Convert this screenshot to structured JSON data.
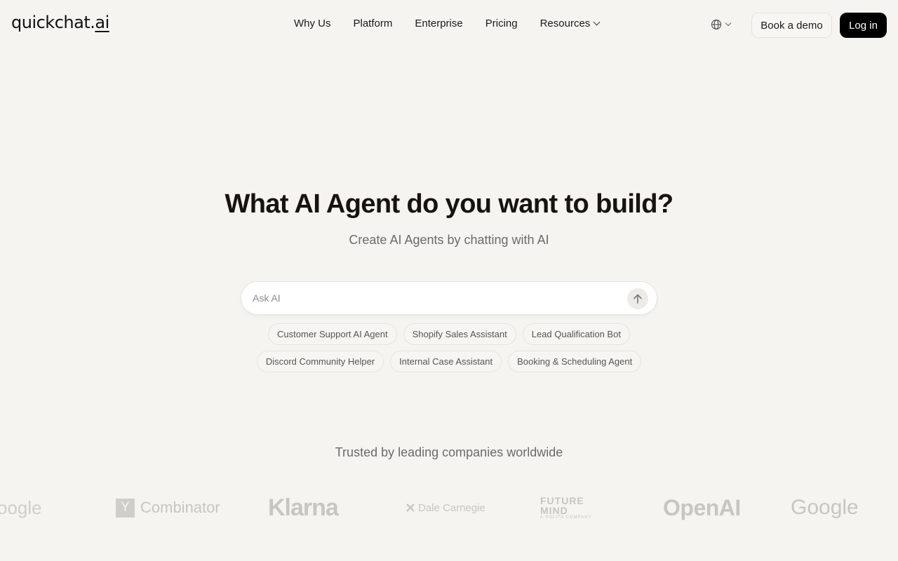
{
  "header": {
    "logo_main": "quickchat.",
    "logo_tld": "ai",
    "nav": [
      {
        "label": "Why Us"
      },
      {
        "label": "Platform"
      },
      {
        "label": "Enterprise"
      },
      {
        "label": "Pricing"
      },
      {
        "label": "Resources",
        "icon": "chevron-down-icon"
      }
    ],
    "language_icon": "globe-icon",
    "book_demo": "Book a demo",
    "login": "Log in"
  },
  "hero": {
    "title": "What AI Agent do you want to build?",
    "subtitle": "Create AI Agents by chatting with AI",
    "input_placeholder": "Ask AI",
    "send_icon": "arrow-up-icon",
    "suggestions_row1": [
      "Customer Support AI Agent",
      "Shopify Sales Assistant",
      "Lead Qualification Bot"
    ],
    "suggestions_row2": [
      "Discord Community Helper",
      "Internal Case Assistant",
      "Booking & Scheduling Agent"
    ]
  },
  "trusted": {
    "heading": "Trusted by leading companies worldwide",
    "logos": {
      "google_partial": "oogle",
      "yc_letter": "Y",
      "yc_word": "Combinator",
      "klarna": "Klarna",
      "dale": "Dale Carnegie",
      "future_line1": "FUTURE",
      "future_line2": "MIND",
      "future_line3": "A SOLITA COMPANY",
      "openai": "OpenAI",
      "google": "Google"
    }
  }
}
